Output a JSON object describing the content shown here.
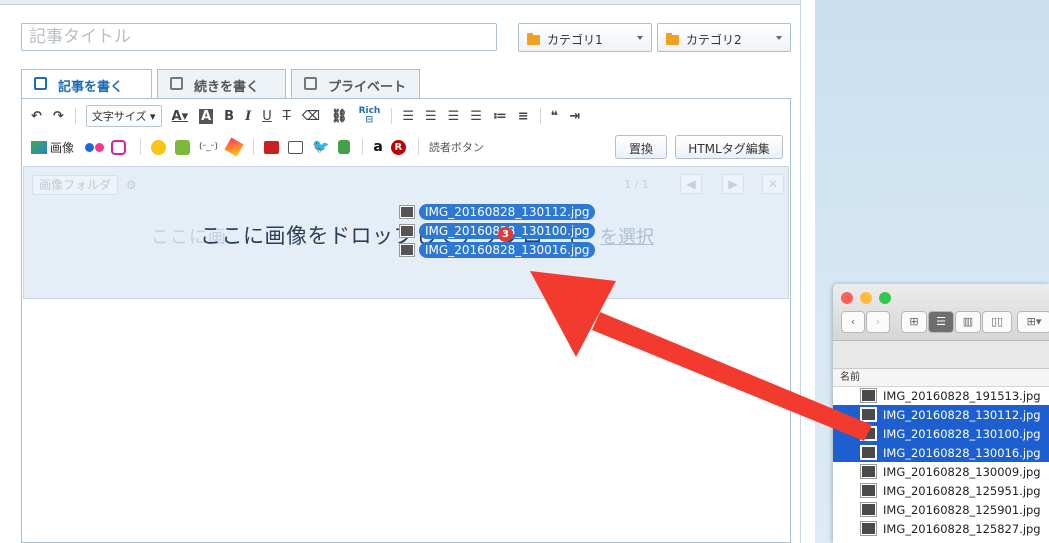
{
  "editor": {
    "title_placeholder": "記事タイトル",
    "category1": "カテゴリ1",
    "category2": "カテゴリ2",
    "tabs": [
      {
        "label": "記事を書く",
        "active": true
      },
      {
        "label": "続きを書く",
        "active": false
      },
      {
        "label": "プライベート",
        "active": false
      }
    ],
    "toolbar": {
      "font_size": "文字サイズ",
      "bold": "B",
      "italic": "I",
      "underline": "U",
      "strike": "T",
      "rich_label": "Rich",
      "quote": "❝",
      "image_label": "画像",
      "reader_button": "読者ボタン",
      "replace_button": "置換",
      "html_button": "HTMLタグ編集"
    },
    "drop_zone": {
      "folder_select": "画像フォルダ",
      "page": "1 / 1",
      "instruction": "ここに画像をドロップしてアップロード",
      "instruction_faded": "ここに画",
      "link": "を選択"
    }
  },
  "drag": {
    "files": [
      "IMG_20160828_130112.jpg",
      "IMG_20160828_130100.jpg",
      "IMG_20160828_130016.jpg"
    ],
    "count": "3"
  },
  "finder": {
    "column_header": "名前",
    "files": [
      {
        "name": "IMG_20160828_191513.jpg",
        "selected": false
      },
      {
        "name": "IMG_20160828_130112.jpg",
        "selected": true
      },
      {
        "name": "IMG_20160828_130100.jpg",
        "selected": true
      },
      {
        "name": "IMG_20160828_130016.jpg",
        "selected": true
      },
      {
        "name": "IMG_20160828_130009.jpg",
        "selected": false
      },
      {
        "name": "IMG_20160828_125951.jpg",
        "selected": false
      },
      {
        "name": "IMG_20160828_125901.jpg",
        "selected": false
      },
      {
        "name": "IMG_20160828_125827.jpg",
        "selected": false
      }
    ]
  },
  "colors": {
    "accent": "#1f6cb7",
    "selection": "#1e5fcf",
    "arrow": "#f23a2e",
    "folder": "#f0a023"
  }
}
